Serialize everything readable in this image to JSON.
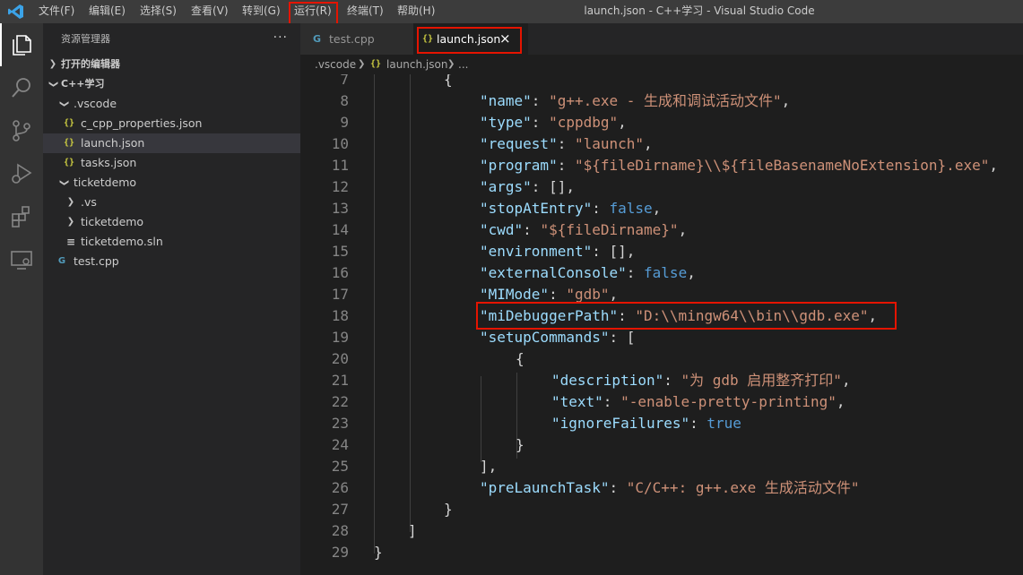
{
  "window": {
    "title": "launch.json - C++学习 - Visual Studio Code",
    "menu": [
      "文件(F)",
      "编辑(E)",
      "选择(S)",
      "查看(V)",
      "转到(G)",
      "运行(R)",
      "终端(T)",
      "帮助(H)"
    ]
  },
  "activity_bar": [
    "explorer-icon",
    "search-icon",
    "source-control-icon",
    "run-debug-icon",
    "extensions-icon",
    "remote-explorer-icon"
  ],
  "sidebar": {
    "header": "资源管理器",
    "more": "···",
    "open_editors_label": "打开的编辑器",
    "workspace_label": "C++学习",
    "tree": [
      {
        "label": ".vscode",
        "kind": "folder-open"
      },
      {
        "label": "c_cpp_properties.json",
        "kind": "json"
      },
      {
        "label": "launch.json",
        "kind": "json",
        "selected": true
      },
      {
        "label": "tasks.json",
        "kind": "json"
      },
      {
        "label": "ticketdemo",
        "kind": "folder-open"
      },
      {
        "label": ".vs",
        "kind": "folder-closed"
      },
      {
        "label": "ticketdemo",
        "kind": "folder-closed"
      },
      {
        "label": "ticketdemo.sln",
        "kind": "sln"
      },
      {
        "label": "test.cpp",
        "kind": "cpp"
      }
    ]
  },
  "tabs": [
    {
      "label": "test.cpp",
      "icon": "cpp-file-icon",
      "active": false
    },
    {
      "label": "launch.json",
      "icon": "json-file-icon",
      "active": true,
      "close": "×"
    }
  ],
  "breadcrumb": {
    "folder": ".vscode",
    "file": "launch.json",
    "rest": "..."
  },
  "editor": {
    "lines": [
      {
        "n": "7",
        "t": [
          [
            "p",
            "{"
          ]
        ]
      },
      {
        "n": "8",
        "t": [
          [
            "k",
            "\"name\""
          ],
          [
            "p",
            ": "
          ],
          [
            "s",
            "\"g++.exe - 生成和调试活动文件\""
          ],
          [
            "p",
            ","
          ]
        ]
      },
      {
        "n": "9",
        "t": [
          [
            "k",
            "\"type\""
          ],
          [
            "p",
            ": "
          ],
          [
            "s",
            "\"cppdbg\""
          ],
          [
            "p",
            ","
          ]
        ]
      },
      {
        "n": "10",
        "t": [
          [
            "k",
            "\"request\""
          ],
          [
            "p",
            ": "
          ],
          [
            "s",
            "\"launch\""
          ],
          [
            "p",
            ","
          ]
        ]
      },
      {
        "n": "11",
        "t": [
          [
            "k",
            "\"program\""
          ],
          [
            "p",
            ": "
          ],
          [
            "s",
            "\"${fileDirname}\\\\${fileBasenameNoExtension}.exe\""
          ],
          [
            "p",
            ","
          ]
        ]
      },
      {
        "n": "12",
        "t": [
          [
            "k",
            "\"args\""
          ],
          [
            "p",
            ": [],"
          ]
        ]
      },
      {
        "n": "13",
        "t": [
          [
            "k",
            "\"stopAtEntry\""
          ],
          [
            "p",
            ": "
          ],
          [
            "b",
            "false"
          ],
          [
            "p",
            ","
          ]
        ]
      },
      {
        "n": "14",
        "t": [
          [
            "k",
            "\"cwd\""
          ],
          [
            "p",
            ": "
          ],
          [
            "s",
            "\"${fileDirname}\""
          ],
          [
            "p",
            ","
          ]
        ]
      },
      {
        "n": "15",
        "t": [
          [
            "k",
            "\"environment\""
          ],
          [
            "p",
            ": [],"
          ]
        ]
      },
      {
        "n": "16",
        "t": [
          [
            "k",
            "\"externalConsole\""
          ],
          [
            "p",
            ": "
          ],
          [
            "b",
            "false"
          ],
          [
            "p",
            ","
          ]
        ]
      },
      {
        "n": "17",
        "t": [
          [
            "k",
            "\"MIMode\""
          ],
          [
            "p",
            ": "
          ],
          [
            "s",
            "\"gdb\""
          ],
          [
            "p",
            ","
          ]
        ]
      },
      {
        "n": "18",
        "t": [
          [
            "k",
            "\"miDebuggerPath\""
          ],
          [
            "p",
            ": "
          ],
          [
            "s",
            "\"D:\\\\mingw64\\\\bin\\\\gdb.exe\""
          ],
          [
            "p",
            ","
          ]
        ]
      },
      {
        "n": "19",
        "t": [
          [
            "k",
            "\"setupCommands\""
          ],
          [
            "p",
            ": ["
          ]
        ]
      },
      {
        "n": "20",
        "t": [
          [
            "p",
            "{"
          ]
        ]
      },
      {
        "n": "21",
        "t": [
          [
            "k",
            "\"description\""
          ],
          [
            "p",
            ": "
          ],
          [
            "s",
            "\"为 gdb 启用整齐打印\""
          ],
          [
            "p",
            ","
          ]
        ]
      },
      {
        "n": "22",
        "t": [
          [
            "k",
            "\"text\""
          ],
          [
            "p",
            ": "
          ],
          [
            "s",
            "\"-enable-pretty-printing\""
          ],
          [
            "p",
            ","
          ]
        ]
      },
      {
        "n": "23",
        "t": [
          [
            "k",
            "\"ignoreFailures\""
          ],
          [
            "p",
            ": "
          ],
          [
            "b",
            "true"
          ]
        ]
      },
      {
        "n": "24",
        "t": [
          [
            "p",
            "}"
          ]
        ]
      },
      {
        "n": "25",
        "t": [
          [
            "p",
            "],"
          ]
        ]
      },
      {
        "n": "26",
        "t": [
          [
            "k",
            "\"preLaunchTask\""
          ],
          [
            "p",
            ": "
          ],
          [
            "s",
            "\"C/C++: g++.exe 生成活动文件\""
          ]
        ]
      },
      {
        "n": "27",
        "t": [
          [
            "p",
            "}"
          ]
        ]
      },
      {
        "n": "28",
        "t": [
          [
            "p",
            "]"
          ]
        ]
      },
      {
        "n": "29",
        "t": [
          [
            "p",
            "}"
          ]
        ]
      }
    ]
  },
  "colors": {
    "key": "#9cdcfe",
    "string": "#ce9178",
    "boolean": "#569cd6",
    "punctuation": "#d4d4d4",
    "highlight_box": "#e51400",
    "json_icon": "#cbcb41",
    "cpp_icon": "#519aba"
  }
}
